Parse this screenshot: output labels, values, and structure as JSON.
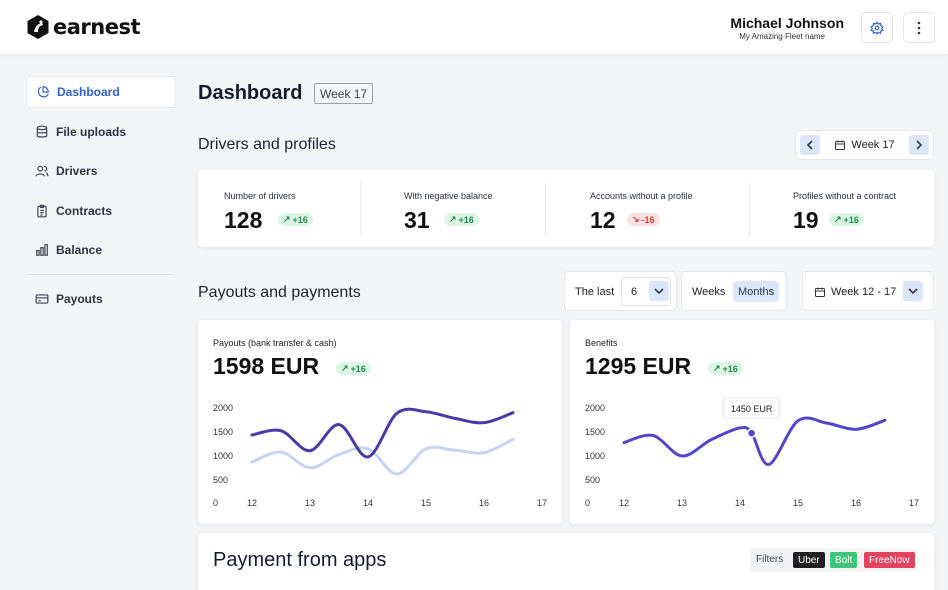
{
  "header": {
    "logo_text": "earnest",
    "user_name": "Michael Johnson",
    "user_org": "My Amazing Fleet name",
    "settings_icon": "gear-icon",
    "more_icon": "more-vertical-icon"
  },
  "sidebar": {
    "items": [
      {
        "label": "Dashboard",
        "icon": "pie-chart-icon",
        "active": true
      },
      {
        "label": "File uploads",
        "icon": "database-icon"
      },
      {
        "label": "Drivers",
        "icon": "users-icon"
      },
      {
        "label": "Contracts",
        "icon": "clipboard-icon"
      },
      {
        "label": "Balance",
        "icon": "bar-chart-icon"
      },
      {
        "label": "Payouts",
        "icon": "credit-card-icon"
      }
    ]
  },
  "page": {
    "title": "Dashboard",
    "week_chip": "Week 17"
  },
  "drivers_section": {
    "title": "Drivers and profiles",
    "week_nav_label": "Week 17",
    "stats": [
      {
        "label": "Number of drivers",
        "value": "128",
        "delta": "+16",
        "direction": "up"
      },
      {
        "label": "With negative balance",
        "value": "31",
        "delta": "+16",
        "direction": "up"
      },
      {
        "label": "Accounts without a profile",
        "value": "12",
        "delta": "-16",
        "direction": "down"
      },
      {
        "label": "Profiles without a contract",
        "value": "19",
        "delta": "+16",
        "direction": "up"
      }
    ]
  },
  "payouts_section": {
    "title": "Payouts and payments",
    "filter": {
      "prefix": "The last",
      "count": "6",
      "units": [
        "Weeks",
        "Months"
      ],
      "active_unit": "Months",
      "range": "Week 12 - 17"
    }
  },
  "charts": {
    "payouts": {
      "label": "Payouts (bank transfer & cash)",
      "value": "1598 EUR",
      "delta": "+16"
    },
    "benefits": {
      "label": "Benefits",
      "value": "1295 EUR",
      "delta": "+16",
      "tooltip": "1450 EUR"
    }
  },
  "chart_data": [
    {
      "type": "line",
      "title": "Payouts (bank transfer & cash)",
      "x": [
        12,
        12.5,
        13,
        13.5,
        14,
        14.5,
        15,
        15.5,
        16,
        16.5
      ],
      "xticks": [
        "12",
        "13",
        "14",
        "15",
        "16",
        "17"
      ],
      "yticks": [
        "2000",
        "1500",
        "1000",
        "500",
        "0"
      ],
      "ylim": [
        0,
        2000
      ],
      "series": [
        {
          "color": "#4a3aa7",
          "values": [
            1410,
            1500,
            1080,
            1630,
            950,
            1870,
            1900,
            1760,
            1670,
            1880
          ]
        },
        {
          "color": "#c6d3f5",
          "values": [
            840,
            1050,
            720,
            1000,
            1120,
            590,
            1120,
            1090,
            1040,
            1320
          ]
        }
      ]
    },
    {
      "type": "line",
      "title": "Benefits",
      "x": [
        12,
        12.5,
        13,
        13.5,
        14,
        14.2,
        14.5,
        15,
        15.5,
        16,
        16.5
      ],
      "xticks": [
        "12",
        "13",
        "14",
        "15",
        "16",
        "17"
      ],
      "yticks": [
        "2000",
        "1500",
        "1000",
        "500",
        "0"
      ],
      "ylim": [
        0,
        2000
      ],
      "series": [
        {
          "color": "#5446c8",
          "values": [
            1250,
            1400,
            970,
            1310,
            1560,
            1450,
            790,
            1710,
            1660,
            1530,
            1720
          ]
        }
      ]
    }
  ],
  "apps_section": {
    "title": "Payment from apps",
    "filters_label": "Filters",
    "pills": [
      {
        "label": "Uber",
        "color": "#1f1f1f"
      },
      {
        "label": "Bolt",
        "color": "#3ec57a"
      },
      {
        "label": "FreeNow",
        "color": "#e0445e"
      }
    ]
  }
}
